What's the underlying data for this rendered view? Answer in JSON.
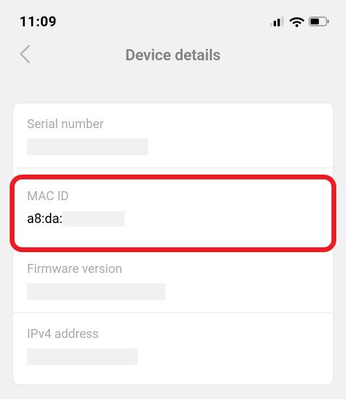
{
  "status": {
    "time": "11:09"
  },
  "nav": {
    "title": "Device details"
  },
  "details": {
    "serial": {
      "label": "Serial number"
    },
    "mac": {
      "label": "MAC ID",
      "value_prefix": "a8:da:"
    },
    "firmware": {
      "label": "Firmware version"
    },
    "ipv4": {
      "label": "IPv4 address"
    }
  },
  "highlight": {
    "target": "mac"
  }
}
